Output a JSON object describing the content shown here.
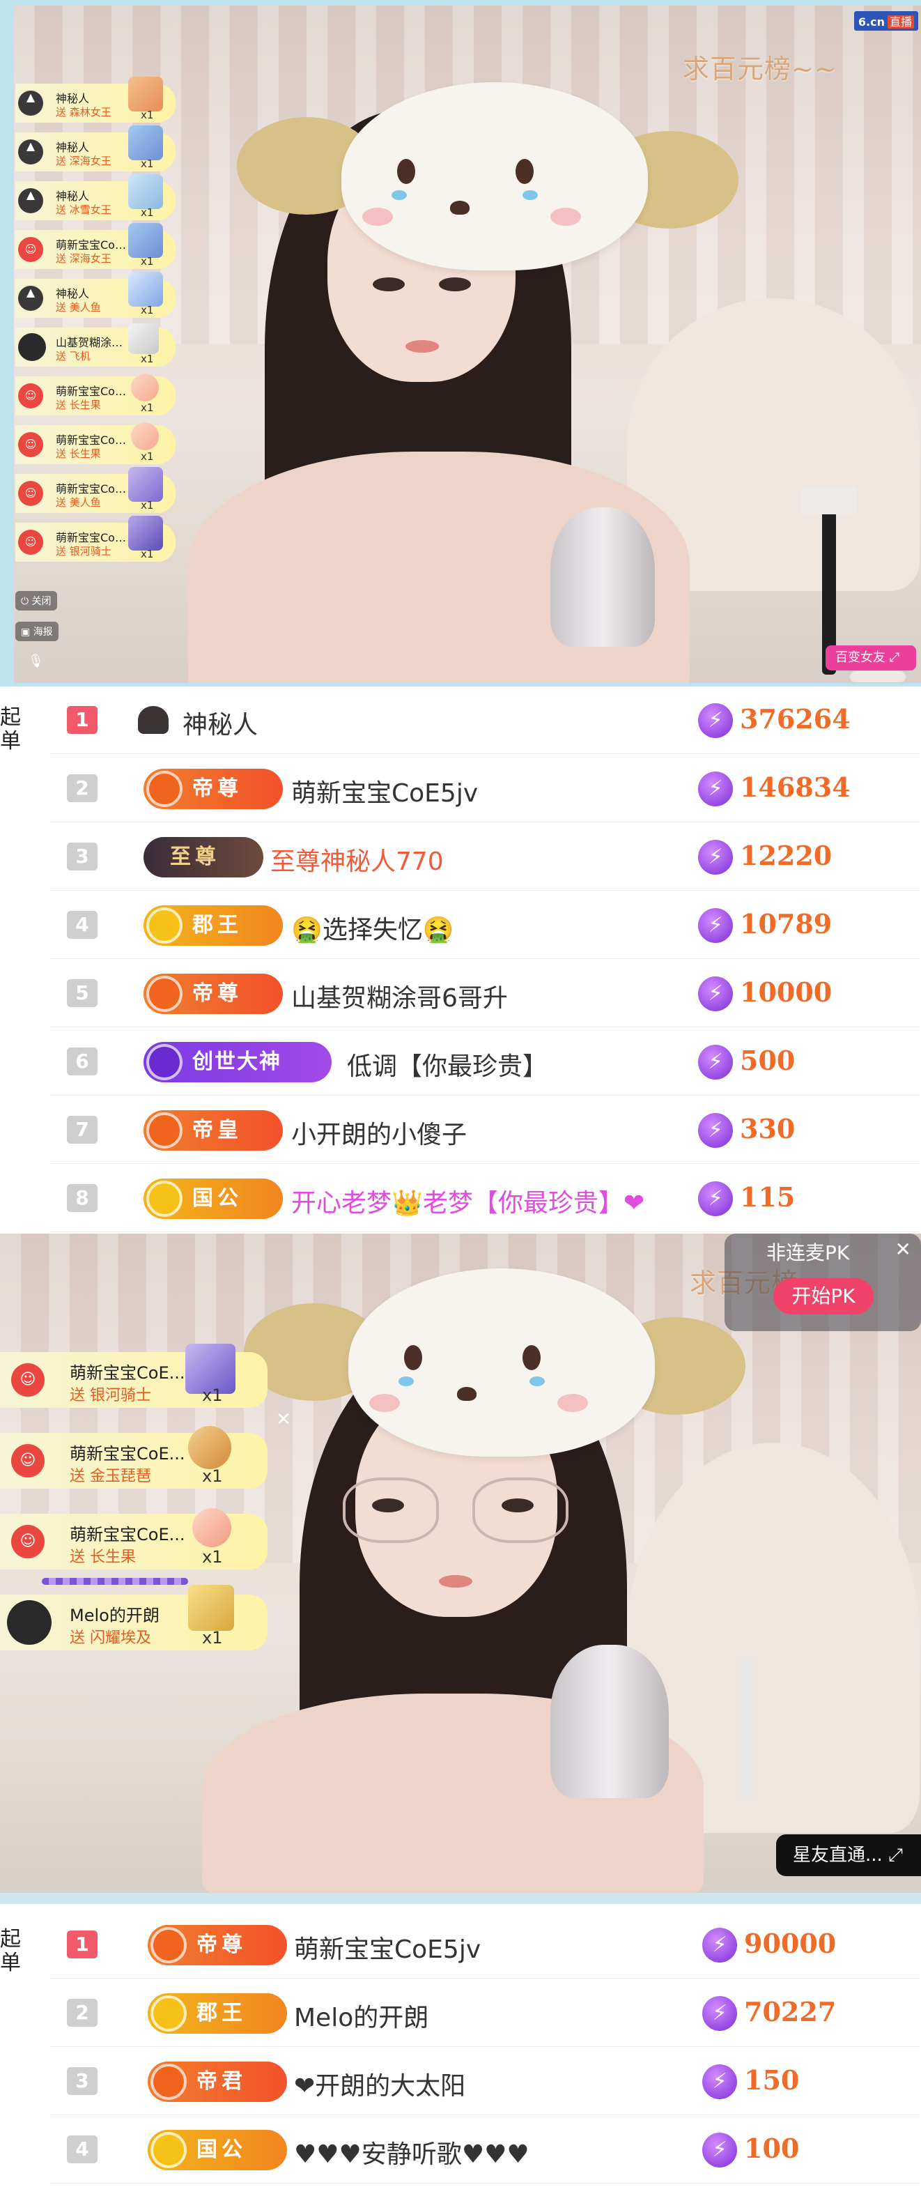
{
  "stream1": {
    "caption": "求百元榜~~",
    "brand": "6.cn",
    "brand_tag": "直播",
    "corner_pill": "百变女友",
    "controls": {
      "close": "关闭",
      "poster": "海报"
    },
    "gifts": [
      {
        "name": "神秘人",
        "action": "送 森林女王",
        "count": "x1",
        "avatar": "hat"
      },
      {
        "name": "神秘人",
        "action": "送 深海女王",
        "count": "x1",
        "avatar": "hat"
      },
      {
        "name": "神秘人",
        "action": "送 冰雪女王",
        "count": "x1",
        "avatar": "hat"
      },
      {
        "name": "萌新宝宝CoE...",
        "action": "送 深海女王",
        "count": "x1",
        "avatar": "red"
      },
      {
        "name": "神秘人",
        "action": "送 美人鱼",
        "count": "x1",
        "avatar": "hat"
      },
      {
        "name": "山基贺糊涂哥...",
        "action": "送 飞机",
        "count": "x1",
        "avatar": "photo"
      },
      {
        "name": "萌新宝宝CoE...",
        "action": "送 长生果",
        "count": "x1",
        "avatar": "red"
      },
      {
        "name": "萌新宝宝CoE...",
        "action": "送 长生果",
        "count": "x1",
        "avatar": "red"
      },
      {
        "name": "萌新宝宝CoE...",
        "action": "送 美人鱼",
        "count": "x1",
        "avatar": "red"
      },
      {
        "name": "萌新宝宝CoE...",
        "action": "送 银河骑士",
        "count": "x1",
        "avatar": "red"
      }
    ]
  },
  "ranking1": {
    "side_label": [
      "起",
      "单"
    ],
    "rows": [
      {
        "rank": "1",
        "badge": "",
        "badge_style": "none",
        "name": "神秘人",
        "score": "376264",
        "name_style": "plain"
      },
      {
        "rank": "2",
        "badge": "帝尊",
        "badge_style": "orange",
        "name": "萌新宝宝CoE5jv",
        "score": "146834",
        "name_style": "plain"
      },
      {
        "rank": "3",
        "badge": "至尊",
        "badge_style": "dark",
        "name": "至尊神秘人770",
        "score": "12220",
        "name_style": "red"
      },
      {
        "rank": "4",
        "badge": "郡王",
        "badge_style": "gold",
        "name": "🤮选择失忆🤮",
        "score": "10789",
        "name_style": "plain"
      },
      {
        "rank": "5",
        "badge": "帝尊",
        "badge_style": "orange",
        "name": "山基贺糊涂哥6哥升",
        "score": "10000",
        "name_style": "plain"
      },
      {
        "rank": "6",
        "badge": "创世大神",
        "badge_style": "purple",
        "name": "低调【你最珍贵】",
        "score": "500",
        "name_style": "plain"
      },
      {
        "rank": "7",
        "badge": "帝皇",
        "badge_style": "orange",
        "name": "小开朗的小傻子",
        "score": "330",
        "name_style": "plain"
      },
      {
        "rank": "8",
        "badge": "国公",
        "badge_style": "gold",
        "name": "开心老梦👑老梦【你最珍贵】❤",
        "score": "115",
        "name_style": "pink"
      }
    ]
  },
  "stream2": {
    "caption": "求百元榜~~",
    "pk_label": "非连麦PK",
    "pk_button": "开始PK",
    "corner_label": "星友直通...",
    "gifts": [
      {
        "name": "萌新宝宝CoE...",
        "action": "送 银河骑士",
        "count": "x1",
        "avatar": "red"
      },
      {
        "name": "萌新宝宝CoE...",
        "action": "送 金玉琵琶",
        "count": "x1",
        "avatar": "red"
      },
      {
        "name": "萌新宝宝CoE...",
        "action": "送 长生果",
        "count": "x1",
        "avatar": "red"
      },
      {
        "name": "Melo的开朗",
        "action": "送 闪耀埃及",
        "count": "x1",
        "avatar": "photo"
      }
    ]
  },
  "ranking2": {
    "side_label": [
      "起",
      "单"
    ],
    "rows": [
      {
        "rank": "1",
        "badge": "帝尊",
        "badge_style": "orange",
        "name": "萌新宝宝CoE5jv",
        "score": "90000"
      },
      {
        "rank": "2",
        "badge": "郡王",
        "badge_style": "gold",
        "name": "Melo的开朗",
        "score": "70227"
      },
      {
        "rank": "3",
        "badge": "帝君",
        "badge_style": "orange",
        "name": "❤开朗的大太阳",
        "score": "150"
      },
      {
        "rank": "4",
        "badge": "国公",
        "badge_style": "gold",
        "name": "♥♥♥安静听歌♥♥♥",
        "score": "100"
      }
    ]
  }
}
